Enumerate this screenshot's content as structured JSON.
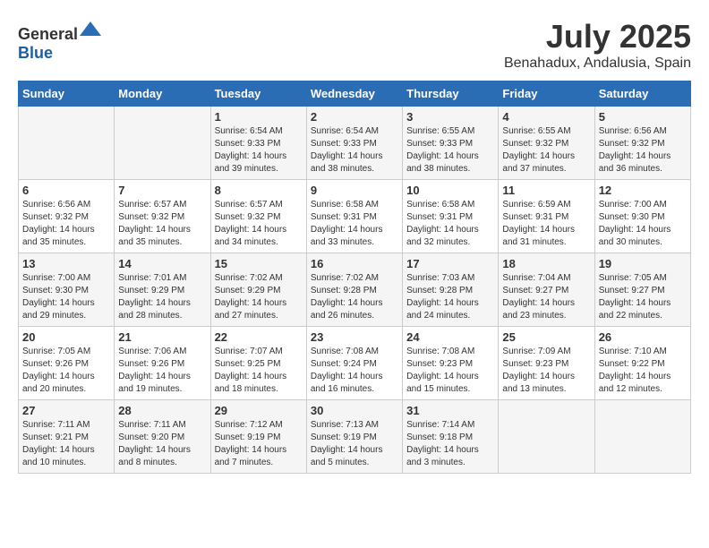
{
  "header": {
    "logo_general": "General",
    "logo_blue": "Blue",
    "month_title": "July 2025",
    "location": "Benahadux, Andalusia, Spain"
  },
  "calendar": {
    "days_of_week": [
      "Sunday",
      "Monday",
      "Tuesday",
      "Wednesday",
      "Thursday",
      "Friday",
      "Saturday"
    ],
    "weeks": [
      [
        {
          "day": "",
          "sunrise": "",
          "sunset": "",
          "daylight": ""
        },
        {
          "day": "",
          "sunrise": "",
          "sunset": "",
          "daylight": ""
        },
        {
          "day": "1",
          "sunrise": "Sunrise: 6:54 AM",
          "sunset": "Sunset: 9:33 PM",
          "daylight": "Daylight: 14 hours and 39 minutes."
        },
        {
          "day": "2",
          "sunrise": "Sunrise: 6:54 AM",
          "sunset": "Sunset: 9:33 PM",
          "daylight": "Daylight: 14 hours and 38 minutes."
        },
        {
          "day": "3",
          "sunrise": "Sunrise: 6:55 AM",
          "sunset": "Sunset: 9:33 PM",
          "daylight": "Daylight: 14 hours and 38 minutes."
        },
        {
          "day": "4",
          "sunrise": "Sunrise: 6:55 AM",
          "sunset": "Sunset: 9:32 PM",
          "daylight": "Daylight: 14 hours and 37 minutes."
        },
        {
          "day": "5",
          "sunrise": "Sunrise: 6:56 AM",
          "sunset": "Sunset: 9:32 PM",
          "daylight": "Daylight: 14 hours and 36 minutes."
        }
      ],
      [
        {
          "day": "6",
          "sunrise": "Sunrise: 6:56 AM",
          "sunset": "Sunset: 9:32 PM",
          "daylight": "Daylight: 14 hours and 35 minutes."
        },
        {
          "day": "7",
          "sunrise": "Sunrise: 6:57 AM",
          "sunset": "Sunset: 9:32 PM",
          "daylight": "Daylight: 14 hours and 35 minutes."
        },
        {
          "day": "8",
          "sunrise": "Sunrise: 6:57 AM",
          "sunset": "Sunset: 9:32 PM",
          "daylight": "Daylight: 14 hours and 34 minutes."
        },
        {
          "day": "9",
          "sunrise": "Sunrise: 6:58 AM",
          "sunset": "Sunset: 9:31 PM",
          "daylight": "Daylight: 14 hours and 33 minutes."
        },
        {
          "day": "10",
          "sunrise": "Sunrise: 6:58 AM",
          "sunset": "Sunset: 9:31 PM",
          "daylight": "Daylight: 14 hours and 32 minutes."
        },
        {
          "day": "11",
          "sunrise": "Sunrise: 6:59 AM",
          "sunset": "Sunset: 9:31 PM",
          "daylight": "Daylight: 14 hours and 31 minutes."
        },
        {
          "day": "12",
          "sunrise": "Sunrise: 7:00 AM",
          "sunset": "Sunset: 9:30 PM",
          "daylight": "Daylight: 14 hours and 30 minutes."
        }
      ],
      [
        {
          "day": "13",
          "sunrise": "Sunrise: 7:00 AM",
          "sunset": "Sunset: 9:30 PM",
          "daylight": "Daylight: 14 hours and 29 minutes."
        },
        {
          "day": "14",
          "sunrise": "Sunrise: 7:01 AM",
          "sunset": "Sunset: 9:29 PM",
          "daylight": "Daylight: 14 hours and 28 minutes."
        },
        {
          "day": "15",
          "sunrise": "Sunrise: 7:02 AM",
          "sunset": "Sunset: 9:29 PM",
          "daylight": "Daylight: 14 hours and 27 minutes."
        },
        {
          "day": "16",
          "sunrise": "Sunrise: 7:02 AM",
          "sunset": "Sunset: 9:28 PM",
          "daylight": "Daylight: 14 hours and 26 minutes."
        },
        {
          "day": "17",
          "sunrise": "Sunrise: 7:03 AM",
          "sunset": "Sunset: 9:28 PM",
          "daylight": "Daylight: 14 hours and 24 minutes."
        },
        {
          "day": "18",
          "sunrise": "Sunrise: 7:04 AM",
          "sunset": "Sunset: 9:27 PM",
          "daylight": "Daylight: 14 hours and 23 minutes."
        },
        {
          "day": "19",
          "sunrise": "Sunrise: 7:05 AM",
          "sunset": "Sunset: 9:27 PM",
          "daylight": "Daylight: 14 hours and 22 minutes."
        }
      ],
      [
        {
          "day": "20",
          "sunrise": "Sunrise: 7:05 AM",
          "sunset": "Sunset: 9:26 PM",
          "daylight": "Daylight: 14 hours and 20 minutes."
        },
        {
          "day": "21",
          "sunrise": "Sunrise: 7:06 AM",
          "sunset": "Sunset: 9:26 PM",
          "daylight": "Daylight: 14 hours and 19 minutes."
        },
        {
          "day": "22",
          "sunrise": "Sunrise: 7:07 AM",
          "sunset": "Sunset: 9:25 PM",
          "daylight": "Daylight: 14 hours and 18 minutes."
        },
        {
          "day": "23",
          "sunrise": "Sunrise: 7:08 AM",
          "sunset": "Sunset: 9:24 PM",
          "daylight": "Daylight: 14 hours and 16 minutes."
        },
        {
          "day": "24",
          "sunrise": "Sunrise: 7:08 AM",
          "sunset": "Sunset: 9:23 PM",
          "daylight": "Daylight: 14 hours and 15 minutes."
        },
        {
          "day": "25",
          "sunrise": "Sunrise: 7:09 AM",
          "sunset": "Sunset: 9:23 PM",
          "daylight": "Daylight: 14 hours and 13 minutes."
        },
        {
          "day": "26",
          "sunrise": "Sunrise: 7:10 AM",
          "sunset": "Sunset: 9:22 PM",
          "daylight": "Daylight: 14 hours and 12 minutes."
        }
      ],
      [
        {
          "day": "27",
          "sunrise": "Sunrise: 7:11 AM",
          "sunset": "Sunset: 9:21 PM",
          "daylight": "Daylight: 14 hours and 10 minutes."
        },
        {
          "day": "28",
          "sunrise": "Sunrise: 7:11 AM",
          "sunset": "Sunset: 9:20 PM",
          "daylight": "Daylight: 14 hours and 8 minutes."
        },
        {
          "day": "29",
          "sunrise": "Sunrise: 7:12 AM",
          "sunset": "Sunset: 9:19 PM",
          "daylight": "Daylight: 14 hours and 7 minutes."
        },
        {
          "day": "30",
          "sunrise": "Sunrise: 7:13 AM",
          "sunset": "Sunset: 9:19 PM",
          "daylight": "Daylight: 14 hours and 5 minutes."
        },
        {
          "day": "31",
          "sunrise": "Sunrise: 7:14 AM",
          "sunset": "Sunset: 9:18 PM",
          "daylight": "Daylight: 14 hours and 3 minutes."
        },
        {
          "day": "",
          "sunrise": "",
          "sunset": "",
          "daylight": ""
        },
        {
          "day": "",
          "sunrise": "",
          "sunset": "",
          "daylight": ""
        }
      ]
    ]
  }
}
